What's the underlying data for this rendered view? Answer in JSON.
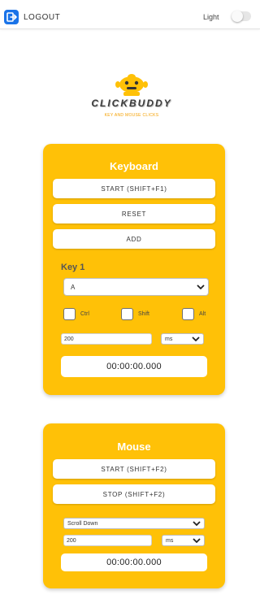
{
  "topbar": {
    "logout_label": "LOGOUT",
    "logout_icon": "logout-icon",
    "theme_label": "Light",
    "theme_toggle_on": false
  },
  "logo": {
    "name": "CLICKBUDDY",
    "tagline": "KEY AND MOUSE CLICKS"
  },
  "colors": {
    "accent": "#ffc107",
    "brand_blue": "#1a73e8",
    "logo_orange": "#f5a000"
  },
  "keyboard": {
    "title": "Keyboard",
    "start_label": "START (SHIFT+F1)",
    "reset_label": "RESET",
    "add_label": "ADD",
    "key_heading": "Key 1",
    "key_value": "A",
    "modifiers": [
      "Ctrl",
      "Shift",
      "Alt"
    ],
    "interval_value": "200",
    "unit_value": "ms",
    "timer": "00:00:00.000"
  },
  "mouse": {
    "title": "Mouse",
    "start_label": "START (SHIFT+F2)",
    "stop_label": "STOP (SHIFT+F2)",
    "action_value": "Scroll Down",
    "interval_value": "200",
    "unit_value": "ms",
    "timer": "00:00:00.000"
  }
}
